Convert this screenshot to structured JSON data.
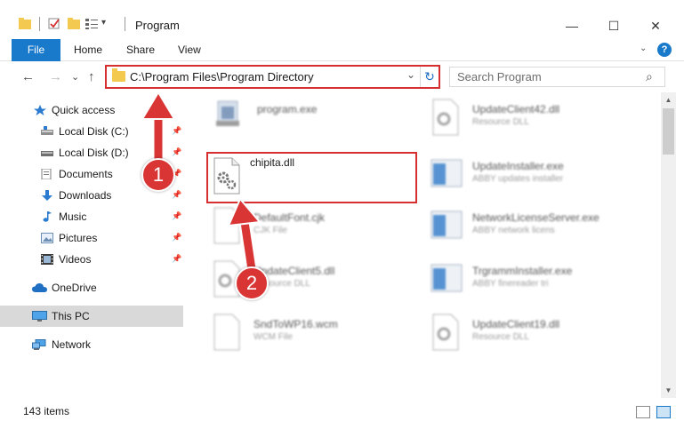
{
  "window": {
    "title": "Program",
    "minimize_glyph": "—",
    "maximize_glyph": "☐",
    "close_glyph": "✕",
    "quick_access_caret": "▾"
  },
  "ribbon": {
    "tabs": [
      {
        "label": "File",
        "active": true
      },
      {
        "label": "Home"
      },
      {
        "label": "Share"
      },
      {
        "label": "View"
      }
    ],
    "expand_glyph": "⌄",
    "help_glyph": "?"
  },
  "nav": {
    "back_glyph": "←",
    "forward_glyph": "→",
    "recent_glyph": "⌄",
    "up_glyph": "↑"
  },
  "address": {
    "path": "C:\\Program Files\\Program Directory",
    "dropdown_glyph": "⌄",
    "refresh_glyph": "↻"
  },
  "search": {
    "placeholder": "Search Program",
    "icon_glyph": "⌕"
  },
  "sidebar": {
    "pin_glyph": "📌",
    "items": [
      {
        "label": "Quick access",
        "icon": "star-icon"
      },
      {
        "label": "Local Disk (C:)",
        "icon": "drive-icon",
        "pinned": true
      },
      {
        "label": "Local Disk (D:)",
        "icon": "drive-icon",
        "pinned": true
      },
      {
        "label": "Documents",
        "icon": "documents-icon",
        "pinned": true
      },
      {
        "label": "Downloads",
        "icon": "download-icon",
        "pinned": true
      },
      {
        "label": "Music",
        "icon": "music-icon",
        "pinned": true
      },
      {
        "label": "Pictures",
        "icon": "pictures-icon",
        "pinned": true
      },
      {
        "label": "Videos",
        "icon": "videos-icon",
        "pinned": true
      },
      {
        "label": "OneDrive",
        "icon": "cloud-icon"
      },
      {
        "label": "This PC",
        "icon": "computer-icon",
        "selected": true
      },
      {
        "label": "Network",
        "icon": "network-icon"
      }
    ]
  },
  "files": [
    {
      "name": "program.exe",
      "sub": "",
      "icon": "program-icon"
    },
    {
      "name": "UpdateClient42.dll",
      "sub": "Resource DLL",
      "icon": "dll-icon"
    },
    {
      "name": "chipita.dll",
      "sub": "",
      "icon": "gear-dll-icon"
    },
    {
      "name": "UpdateInstaller.exe",
      "sub": "ABBY updates installer",
      "icon": "installer-icon"
    },
    {
      "name": "DefaultFont.cjk",
      "sub": "CJK File",
      "icon": "blank-file-icon"
    },
    {
      "name": "NetworkLicenseServer.exe",
      "sub": "ABBY network licens",
      "icon": "installer-icon"
    },
    {
      "name": "UpdateClient5.dll",
      "sub": "Resource DLL",
      "icon": "dll-icon"
    },
    {
      "name": "TrgrammInstaller.exe",
      "sub": "ABBY finereader tri",
      "icon": "installer-icon"
    },
    {
      "name": "SndToWP16.wcm",
      "sub": "WCM File",
      "icon": "blank-file-icon"
    },
    {
      "name": "UpdateClient19.dll",
      "sub": "Resource DLL",
      "icon": "dll-icon"
    }
  ],
  "scrollbar": {
    "up_glyph": "▲",
    "down_glyph": "▼"
  },
  "status": {
    "item_count": "143 items"
  },
  "annotations": {
    "step1": "1",
    "step2": "2"
  },
  "colors": {
    "accent": "#1979ca",
    "highlight": "#d62f2f",
    "badge": "#d93535",
    "folder": "#f3c94f"
  }
}
